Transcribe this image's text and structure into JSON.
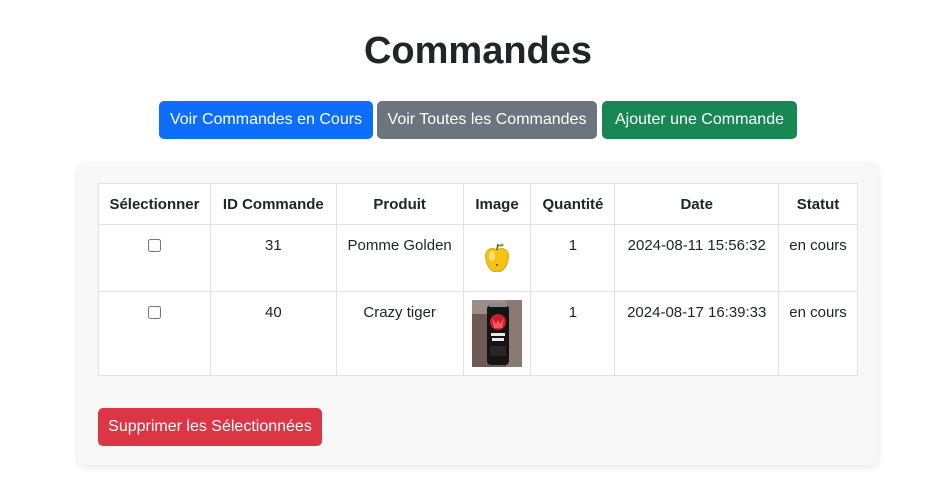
{
  "page": {
    "title": "Commandes"
  },
  "actions": {
    "current_orders_label": "Voir Commandes en Cours",
    "all_orders_label": "Voir Toutes les Commandes",
    "add_order_label": "Ajouter une Commande",
    "delete_selected_label": "Supprimer les Sélectionnées"
  },
  "table": {
    "headers": [
      "Sélectionner",
      "ID Commande",
      "Produit",
      "Image",
      "Quantité",
      "Date",
      "Statut"
    ],
    "rows": [
      {
        "id": "31",
        "product": "Pomme Golden",
        "image": "golden-apple-icon",
        "quantity": "1",
        "date": "2024-08-11 15:56:32",
        "status": "en cours",
        "selected": false
      },
      {
        "id": "40",
        "product": "Crazy tiger",
        "image": "crazy-tiger-can-photo",
        "quantity": "1",
        "date": "2024-08-17 16:39:33",
        "status": "en cours",
        "selected": false
      }
    ]
  },
  "colors": {
    "primary": "#0d6efd",
    "secondary": "#6c757d",
    "success": "#198754",
    "danger": "#dc3545"
  }
}
